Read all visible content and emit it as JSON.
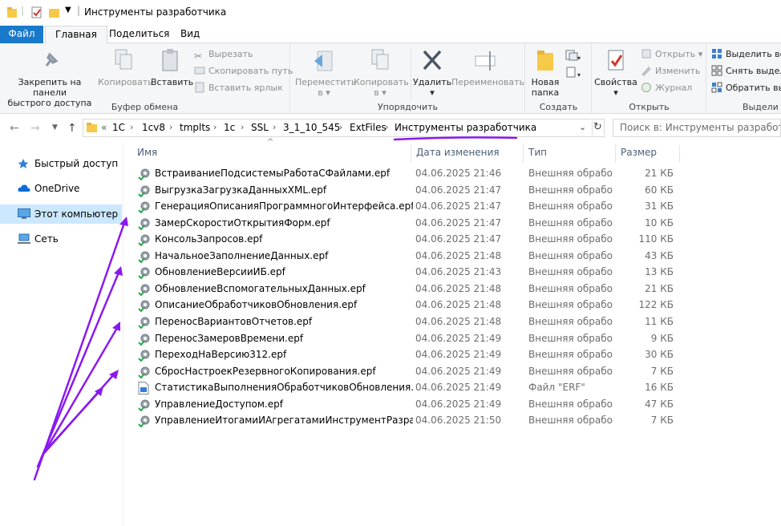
{
  "window": {
    "title": "Инструменты разработчика"
  },
  "ribbon_tabs": [
    "Файл",
    "Главная",
    "Поделиться",
    "Вид"
  ],
  "ribbon": {
    "clipboard": {
      "label": "Буфер обмена",
      "pin_line1": "Закрепить на панели",
      "pin_line2": "быстрого доступа",
      "copy": "Копировать",
      "paste": "Вставить",
      "cut": "Вырезать",
      "copy_path": "Скопировать путь",
      "paste_shortcut": "Вставить ярлык"
    },
    "organize": {
      "label": "Упорядочить",
      "move_line1": "Переместить",
      "move_line2": "в ▾",
      "copyto_line1": "Копировать",
      "copyto_line2": "в ▾",
      "delete_line1": "Удалить",
      "delete_line2": "▾",
      "rename": "Переименовать"
    },
    "create": {
      "label": "Создать",
      "newfolder_line1": "Новая",
      "newfolder_line2": "папка"
    },
    "open": {
      "label": "Открыть",
      "props_line1": "Свойства",
      "props_line2": "▾",
      "open": "Открыть ▾",
      "edit": "Изменить",
      "history": "Журнал"
    },
    "select": {
      "label": "Выдели",
      "select_all": "Выделить все",
      "select_none": "Снять выделе",
      "invert": "Обратить выд"
    }
  },
  "address": {
    "overflow": "«",
    "crumbs": [
      "1C",
      "1cv8",
      "tmplts",
      "1c",
      "SSL",
      "3_1_10_545",
      "ExtFiles",
      "Инструменты разработчика"
    ],
    "search_placeholder": "Поиск в: Инструменты разработчика"
  },
  "nav": {
    "items": [
      "Быстрый доступ",
      "OneDrive",
      "Этот компьютер",
      "Сеть"
    ]
  },
  "columns": {
    "name": "Имя",
    "date": "Дата изменения",
    "type": "Тип",
    "size": "Размер"
  },
  "files": [
    {
      "name": "ВстраиваниеПодсистемыРаботаСФайлами.epf",
      "date": "04.06.2025 21:46",
      "type": "Внешняя обрабо...",
      "size": "21 КБ",
      "icon": "epf-gear-icon"
    },
    {
      "name": "ВыгрузкаЗагрузкаДанныхXML.epf",
      "date": "04.06.2025 21:47",
      "type": "Внешняя обрабо...",
      "size": "60 КБ",
      "icon": "epf-gear-icon"
    },
    {
      "name": "ГенерацияОписанияПрограммногоИнтерфейса.epf",
      "date": "04.06.2025 21:47",
      "type": "Внешняя обрабо...",
      "size": "31 КБ",
      "icon": "epf-gear-icon"
    },
    {
      "name": "ЗамерСкоростиОткрытияФорм.epf",
      "date": "04.06.2025 21:47",
      "type": "Внешняя обрабо...",
      "size": "10 КБ",
      "icon": "epf-gear-icon"
    },
    {
      "name": "КонсольЗапросов.epf",
      "date": "04.06.2025 21:47",
      "type": "Внешняя обрабо...",
      "size": "110 КБ",
      "icon": "epf-gear-icon"
    },
    {
      "name": "НачальноеЗаполнениеДанных.epf",
      "date": "04.06.2025 21:48",
      "type": "Внешняя обрабо...",
      "size": "43 КБ",
      "icon": "epf-gear-icon"
    },
    {
      "name": "ОбновлениеВерсииИБ.epf",
      "date": "04.06.2025 21:43",
      "type": "Внешняя обрабо...",
      "size": "13 КБ",
      "icon": "epf-gear-icon"
    },
    {
      "name": "ОбновлениеВспомогательныхДанных.epf",
      "date": "04.06.2025 21:48",
      "type": "Внешняя обрабо...",
      "size": "21 КБ",
      "icon": "epf-gear-icon"
    },
    {
      "name": "ОписаниеОбработчиковОбновления.epf",
      "date": "04.06.2025 21:48",
      "type": "Внешняя обрабо...",
      "size": "122 КБ",
      "icon": "epf-gear-icon"
    },
    {
      "name": "ПереносВариантовОтчетов.epf",
      "date": "04.06.2025 21:48",
      "type": "Внешняя обрабо...",
      "size": "11 КБ",
      "icon": "epf-gear-icon"
    },
    {
      "name": "ПереносЗамеровВремени.epf",
      "date": "04.06.2025 21:49",
      "type": "Внешняя обрабо...",
      "size": "9 КБ",
      "icon": "epf-gear-icon"
    },
    {
      "name": "ПереходНаВерсию312.epf",
      "date": "04.06.2025 21:49",
      "type": "Внешняя обрабо...",
      "size": "30 КБ",
      "icon": "epf-gear-icon"
    },
    {
      "name": "СбросНастроекРезервногоКопирования.epf",
      "date": "04.06.2025 21:49",
      "type": "Внешняя обрабо...",
      "size": "7 КБ",
      "icon": "epf-gear-icon"
    },
    {
      "name": "СтатистикаВыполненияОбработчиковОбновления.erf",
      "date": "04.06.2025 21:49",
      "type": "Файл \"ERF\"",
      "size": "16 КБ",
      "icon": "erf-file-icon"
    },
    {
      "name": "УправлениеДоступом.epf",
      "date": "04.06.2025 21:49",
      "type": "Внешняя обрабо...",
      "size": "47 КБ",
      "icon": "epf-gear-icon"
    },
    {
      "name": "УправлениеИтогамиИАгрегатамиИнструментРазработчи...",
      "date": "04.06.2025 21:50",
      "type": "Внешняя обрабо...",
      "size": "7 КБ",
      "icon": "epf-gear-icon"
    }
  ],
  "colors": {
    "accent": "#1979ca",
    "annotation": "#8a19f0",
    "selection": "#cce8ff"
  }
}
